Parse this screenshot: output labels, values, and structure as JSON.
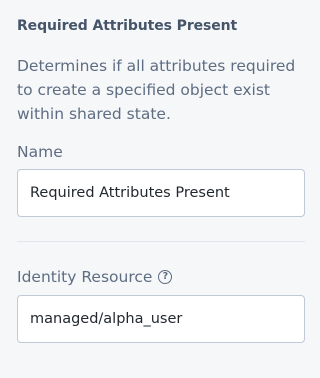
{
  "node": {
    "title": "Required Attributes Present",
    "description": "Determines if all attributes required to create a specified object exist within shared state."
  },
  "fields": {
    "name": {
      "label": "Name",
      "value": "Required Attributes Present"
    },
    "identity_resource": {
      "label": "Identity Resource",
      "help_icon": "question-circle-icon",
      "value": "managed/alpha_user"
    }
  },
  "colors": {
    "background": "#f6f7f9",
    "text": "#455469",
    "input_border": "#c0c9d5"
  }
}
